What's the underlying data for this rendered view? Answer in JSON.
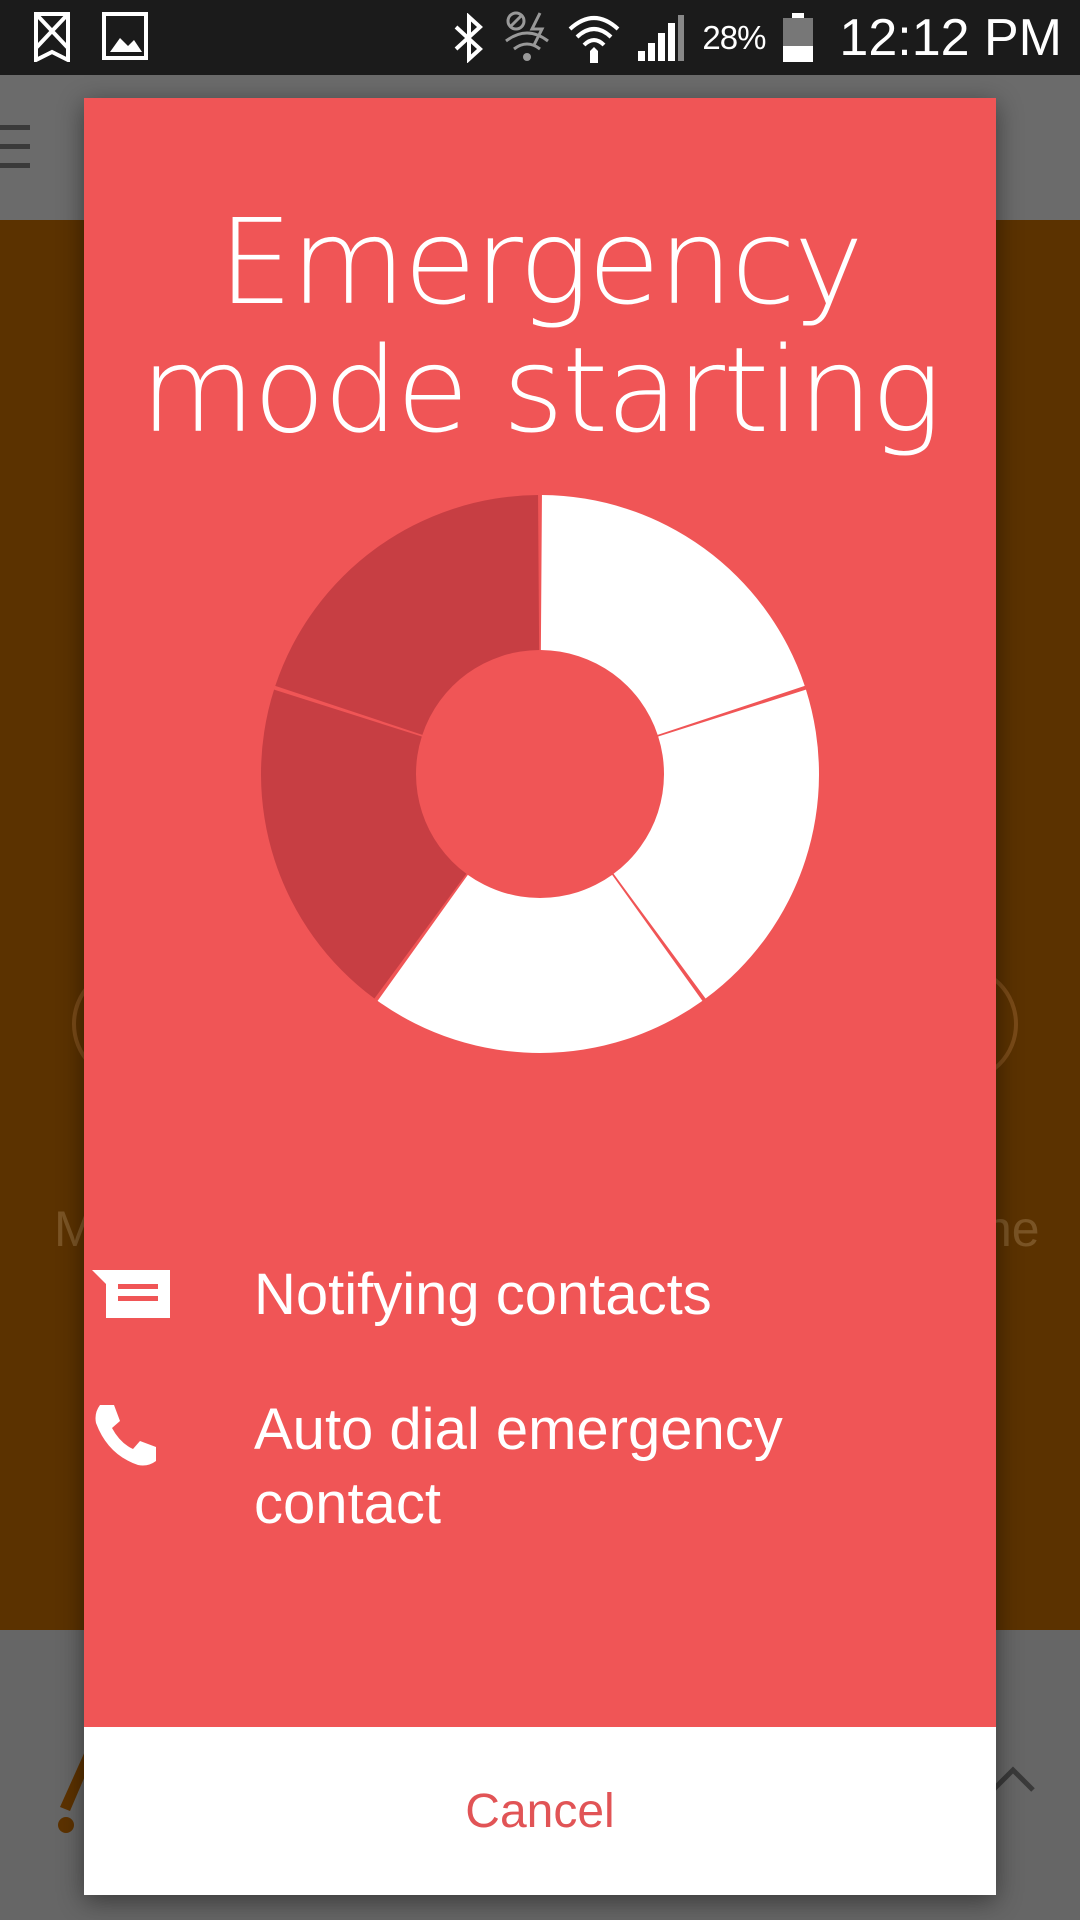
{
  "status_bar": {
    "battery_percent": "28%",
    "time": "12:12 PM",
    "icons": [
      "signal-off-icon",
      "image-icon",
      "bluetooth-icon",
      "wifi-off-icon",
      "wifi-icon",
      "cell-signal-icon",
      "battery-icon"
    ]
  },
  "background": {
    "left_label": "M",
    "right_label": "ne"
  },
  "dialog": {
    "title_line1": "Emergency",
    "title_line2": "mode starting",
    "countdown": {
      "segments_total": 5,
      "segments_remaining": 3
    },
    "items": [
      {
        "icon": "message-icon",
        "label": "Notifying contacts"
      },
      {
        "icon": "phone-icon",
        "label": "Auto dial emergency contact"
      }
    ],
    "cancel_label": "Cancel"
  },
  "colors": {
    "dialog_bg": "#f05556",
    "donut_done": "#c73e43",
    "donut_remaining": "#ffffff",
    "cancel_text": "#e15456",
    "background_body": "#5b3200"
  }
}
